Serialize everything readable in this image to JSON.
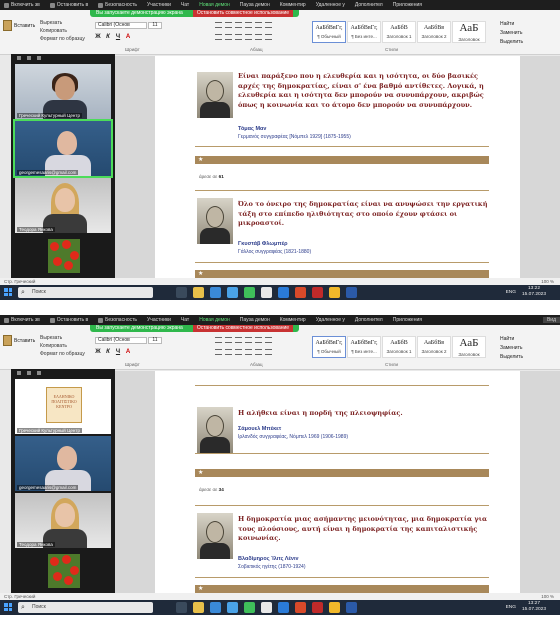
{
  "zoom_toolbar": {
    "items": [
      "Включить зв",
      "Остановить в",
      "Безопасность",
      "Участники",
      "Чат",
      "Новая демон",
      "Пауза демон",
      "Комментир",
      "Удаленное у",
      "Дополнител",
      "Приложения",
      "Дополнит"
    ],
    "share_notice": "Вы запускаете демонстрацию экрана",
    "stop_share": "Остановить совместное использование",
    "hide_label": "Вид"
  },
  "ribbon": {
    "clipboard": {
      "paste": "Вставить",
      "cut": "Вырезать",
      "copy": "Копировать",
      "format": "Формат по образцу"
    },
    "font_name": "Calibri (Основ",
    "font_size": "11",
    "format_buttons": [
      "Ж",
      "К",
      "Ч",
      "A"
    ],
    "group_font": "Шрифт",
    "group_paragraph": "Абзац",
    "group_styles": "Стили",
    "styles": [
      {
        "sample": "АаБбВвГг,",
        "label": "¶ Обычный"
      },
      {
        "sample": "АаБбВвГг,",
        "label": "¶ Без инте..."
      },
      {
        "sample": "АаБбВ",
        "label": "Заголовок 1"
      },
      {
        "sample": "АаБбВв",
        "label": "Заголовок 2"
      },
      {
        "sample": "АаБ",
        "label": "Заголовок"
      }
    ],
    "editing": {
      "find": "Найти",
      "replace": "Заменить",
      "select": "Выделить"
    }
  },
  "frames": [
    {
      "time": "13:22",
      "date": "15.07.2023",
      "participants": [
        {
          "name": "Греческий Культурный Центр"
        },
        {
          "name": "georgemesaaris@gmail.com"
        },
        {
          "name": "Теодора Янкова"
        },
        {
          "name": "Elena"
        }
      ],
      "quotes": [
        {
          "text": "Είναι παράξενο που η ελευθερία και η ισότητα, οι δύο βασικές αρχές της δημοκρατίας, είναι σ' ένα βαθμό αντίθετες. Λογικά, η ελευθερία και η ισότητα δεν μπορούν να συνυπάρχουν, ακριβώς όπως η κοινωνία και το άτομο δεν μπορούν να συνυπάρχουν.",
          "author": "Τόμας Μαν",
          "desc": "Γερμανός συγγραφέας [Νόμπελ 1929]  (1875-1955)",
          "page_ref": "άρεσε σε",
          "page_num": "61"
        },
        {
          "text": "Όλο το όνειρο της δημοκρατίας είναι να ανυψώσει την εργατική τάξη στο επίπεδο ηλιθιότητας στο οποίο έχουν φτάσει οι μικροαστοί.",
          "author": "Γκυστάβ Φλωμπέρ",
          "desc": "Γάλλος συγγραφέας  (1821-1880)"
        }
      ]
    },
    {
      "time": "13:27",
      "date": "15.07.2023",
      "participants": [
        {
          "name": "Греческий Культурный Центр",
          "logo": "ΕΛΛΗΝΙΚΟ ΠΟΛΙΤΙΣΤΙΚΟ ΚΕΝΤΡΟ"
        },
        {
          "name": "georgemesaaris@gmail.com"
        },
        {
          "name": "Теодора Янкова"
        },
        {
          "name": "Elena"
        }
      ],
      "quotes": [
        {
          "text": "Η αλήθεια είναι η πορδή της πλειοψηφίας.",
          "author": "Σάμουελ Μπέκετ",
          "desc": "Ιρλανδός συγγραφέας, Νόμπελ 1969  (1906-1989)",
          "page_ref": "άρεσε σε",
          "page_num": "34"
        },
        {
          "text": "Η δημοκρατία μιας ασήμαντης μειονότητας, μια δημοκρατία για τους πλούσιους, αυτή είναι η δημοκρατία της καπιταλιστικής κοινωνίας.",
          "author": "Βλαδίμηρος Ίλιτς Λένιν",
          "desc": "Σοβιετικός ηγέτης  (1870-1924)"
        }
      ]
    }
  ],
  "statusbar": {
    "language": "Стр.  Греческий",
    "zoom": "100 %"
  },
  "taskbar": {
    "search_placeholder": "Поиск",
    "lang": "ENG",
    "star": "★"
  },
  "colors": {
    "quote": "#7a1f1f",
    "author": "#2b3b8a",
    "rule": "#a8885a",
    "stop": "#c83232",
    "active": "#4cdc5a"
  }
}
